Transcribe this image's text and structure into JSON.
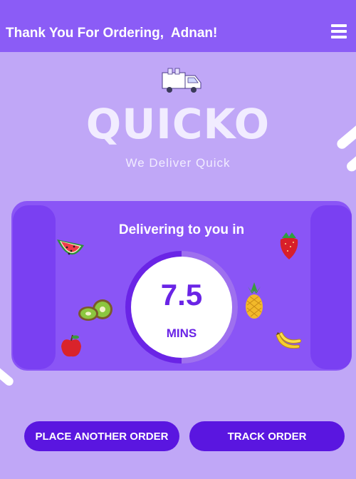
{
  "header": {
    "title": "Thank You For Ordering,  Adnan!"
  },
  "brand": {
    "name": "QUICKO",
    "tagline": "We Deliver Quick"
  },
  "delivery": {
    "heading": "Delivering to you in",
    "time_value": "7.5",
    "time_unit": "MINS",
    "progress_fraction": 0.5
  },
  "buttons": {
    "place_another": "PLACE ANOTHER ORDER",
    "track": "TRACK ORDER"
  },
  "colors": {
    "header_bg": "#8b5cf6",
    "page_bg": "#c0a7f7",
    "card_bg": "#8a55f6",
    "button_bg": "#5a16e0",
    "accent_text": "#6a24e6"
  },
  "icons": [
    "menu-icon",
    "delivery-truck-icon",
    "watermelon-icon",
    "strawberry-icon",
    "kiwi-icon",
    "pineapple-icon",
    "apple-icon",
    "banana-icon"
  ]
}
